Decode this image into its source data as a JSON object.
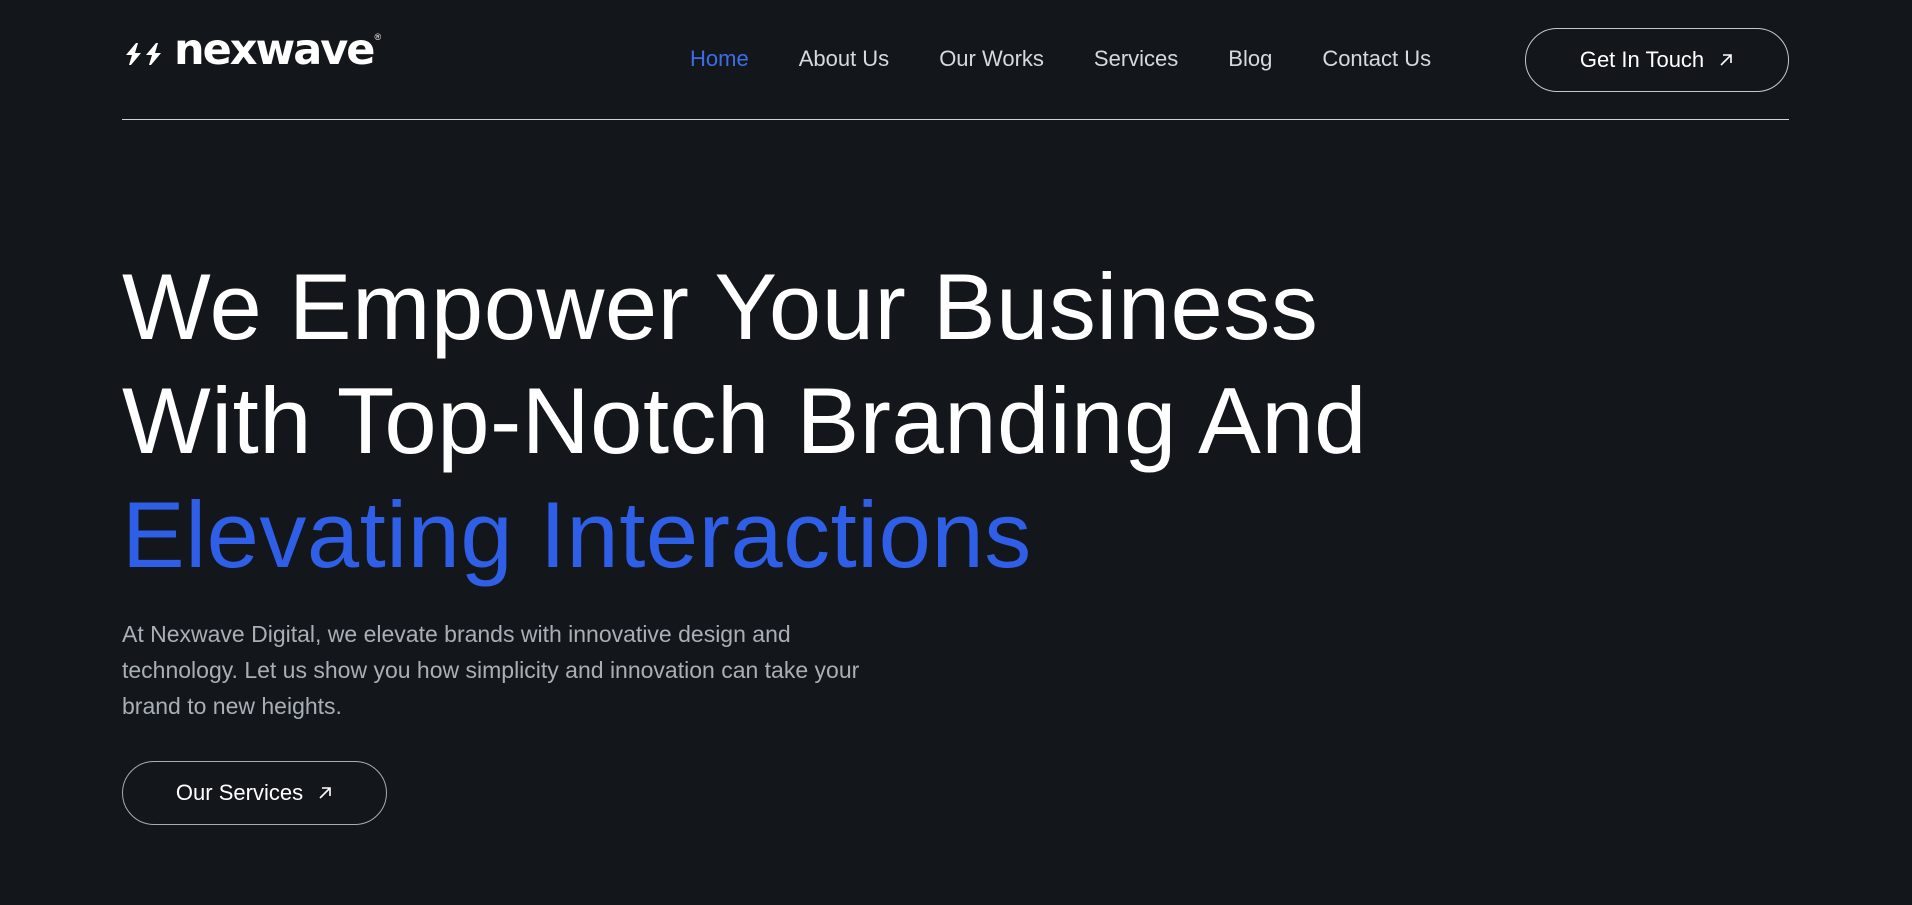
{
  "brand": {
    "name": "nexwave",
    "registered": "®",
    "logo_icon": "double-bolt-logo-icon"
  },
  "nav": {
    "items": [
      {
        "label": "Home",
        "active": true
      },
      {
        "label": "About Us",
        "active": false
      },
      {
        "label": "Our Works",
        "active": false
      },
      {
        "label": "Services",
        "active": false
      },
      {
        "label": "Blog",
        "active": false
      },
      {
        "label": "Contact Us",
        "active": false
      }
    ],
    "cta_label": "Get In Touch",
    "cta_icon": "arrow-up-right-icon"
  },
  "hero": {
    "title_line_1": "We Empower Your Business",
    "title_line_2": "With Top-Notch Branding And",
    "title_line_3": "Elevating Interactions",
    "description": "At Nexwave Digital, we elevate brands with innovative design and technology. Let us show you how simplicity and innovation can take your brand to new heights.",
    "button_label": "Our Services",
    "button_icon": "arrow-up-right-icon"
  },
  "colors": {
    "background": "#13171b",
    "accent": "#2f5fe6",
    "nav_active": "#3d6de6",
    "text_primary": "#ffffff",
    "text_muted": "#a9afb6"
  }
}
